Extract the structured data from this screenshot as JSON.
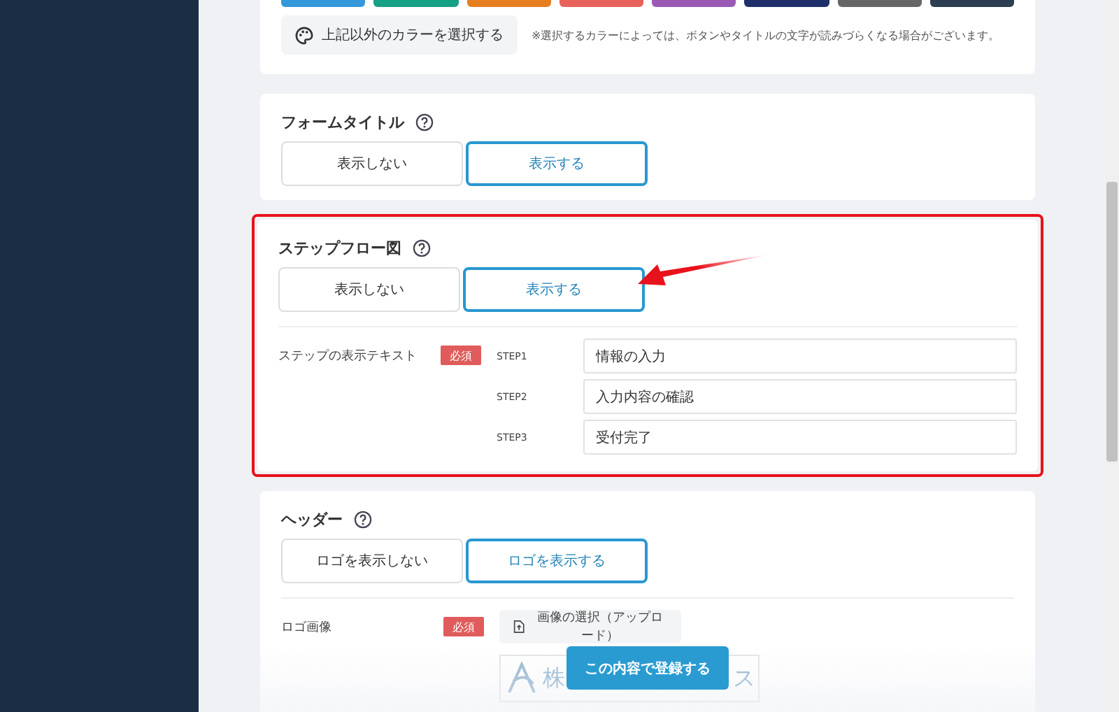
{
  "color_card": {
    "swatches": [
      {
        "color": "#3498db"
      },
      {
        "color": "#16a085"
      },
      {
        "color": "#e67e22"
      },
      {
        "color": "#e8625c"
      },
      {
        "color": "#9b59b6"
      },
      {
        "color": "#1e2f6b"
      },
      {
        "color": "#666666"
      },
      {
        "color": "#2c3e50"
      }
    ],
    "custom_color_button": "上記以外のカラーを選択する",
    "note": "※選択するカラーによっては、ボタンやタイトルの文字が読みづらくなる場合がございます。"
  },
  "sections": [
    {
      "title": "フォームタイトル",
      "highlighted": false,
      "options": [
        {
          "label": "表示しない",
          "selected": false
        },
        {
          "label": "表示する",
          "selected": true
        }
      ]
    },
    {
      "title": "ステップフロー図",
      "highlighted": true,
      "options": [
        {
          "label": "表示しない",
          "selected": false
        },
        {
          "label": "表示する",
          "selected": true
        }
      ],
      "field": {
        "kind": "steps",
        "label": "ステップの表示テキスト",
        "badge": "必須",
        "steps": [
          {
            "name": "STEP1",
            "value": "情報の入力"
          },
          {
            "name": "STEP2",
            "value": "入力内容の確認"
          },
          {
            "name": "STEP3",
            "value": "受付完了"
          }
        ]
      }
    },
    {
      "title": "ヘッダー",
      "highlighted": false,
      "options": [
        {
          "label": "ロゴを表示しない",
          "selected": false
        },
        {
          "label": "ロゴを表示する",
          "selected": true
        }
      ],
      "field": {
        "kind": "upload",
        "label": "ロゴ画像",
        "badge": "必須",
        "button": "画像の選択（アップロード）",
        "preview_start": "株",
        "preview_end": "ス"
      }
    }
  ],
  "submit_button": "この内容で登録する"
}
